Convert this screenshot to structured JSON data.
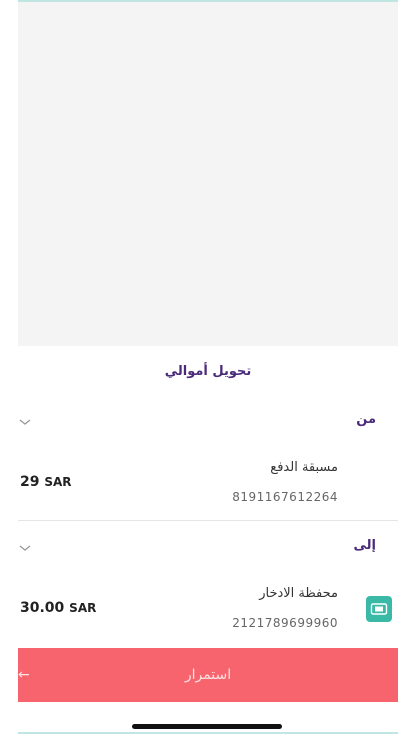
{
  "sheet": {
    "title": "تحويل أموالي"
  },
  "from": {
    "label": "من",
    "account_name": "مسبقة الدفع",
    "account_number": "8191167612264",
    "amount": "29",
    "currency": "SAR"
  },
  "to": {
    "label": "إلى",
    "account_name": "محفظة الادخار",
    "account_number": "2121789699960",
    "amount": "30.00",
    "currency": "SAR",
    "icon": "wallet-icon"
  },
  "actions": {
    "continue_label": "استمرار"
  },
  "colors": {
    "accent_purple": "#4a2a7a",
    "button_red": "#f8646e",
    "teal": "#39b9a6"
  }
}
